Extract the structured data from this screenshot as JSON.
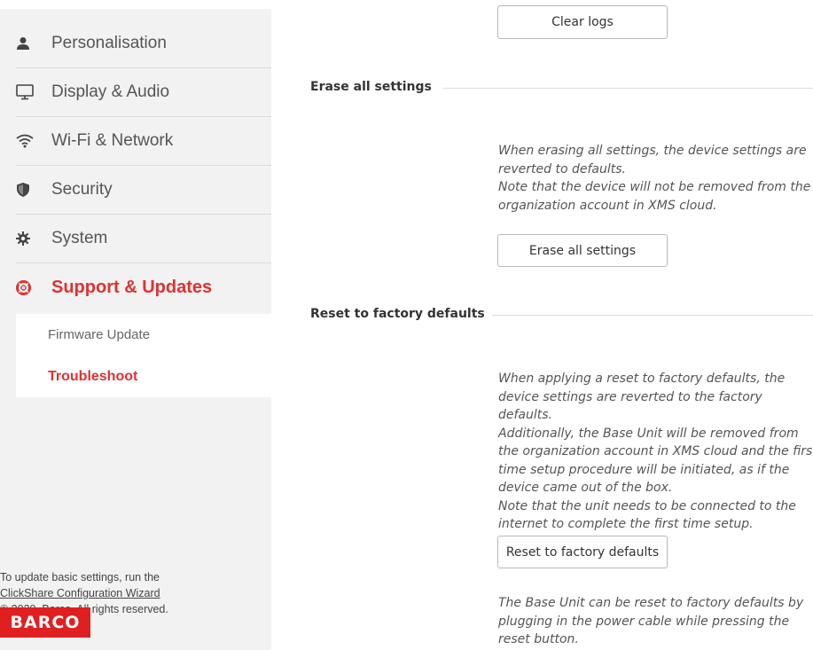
{
  "sidebar": {
    "items": [
      {
        "label": "Personalisation",
        "icon": "person-icon"
      },
      {
        "label": "Display & Audio",
        "icon": "monitor-icon"
      },
      {
        "label": "Wi-Fi & Network",
        "icon": "wifi-icon"
      },
      {
        "label": "Security",
        "icon": "shield-icon"
      },
      {
        "label": "System",
        "icon": "gear-icon"
      },
      {
        "label": "Support & Updates",
        "icon": "lifebuoy-icon"
      }
    ],
    "subitems": [
      {
        "label": "Firmware Update"
      },
      {
        "label": "Troubleshoot"
      }
    ],
    "footer": {
      "line1": "To update basic settings, run the",
      "link": "ClickShare Configuration Wizard",
      "line3": "© 2020, Barco. All rights reserved."
    },
    "logo": "BARCO"
  },
  "main": {
    "clear_logs_label": "Clear logs",
    "erase": {
      "title": "Erase all settings",
      "description": "When erasing all settings, the device settings are\nreverted to defaults.\nNote that the device will not be removed from the\norganization account in XMS cloud.",
      "button": "Erase all settings"
    },
    "reset": {
      "title": "Reset to factory defaults",
      "description": "When applying a reset to factory defaults, the\ndevice settings are reverted to the factory defaults.\nAdditionally, the Base Unit will be removed from\nthe organization account in XMS cloud and the first\ntime setup procedure will be initiated, as if the\ndevice came out of the box.\nNote that the unit needs to be connected to the\ninternet to complete the first time setup.",
      "button": "Reset to factory defaults",
      "note": "The Base Unit can be reset to factory defaults by\nplugging in the power cable while pressing the\nreset button."
    }
  },
  "colors": {
    "accent": "#e03131",
    "sidebar_bg": "#f2f2f2"
  }
}
